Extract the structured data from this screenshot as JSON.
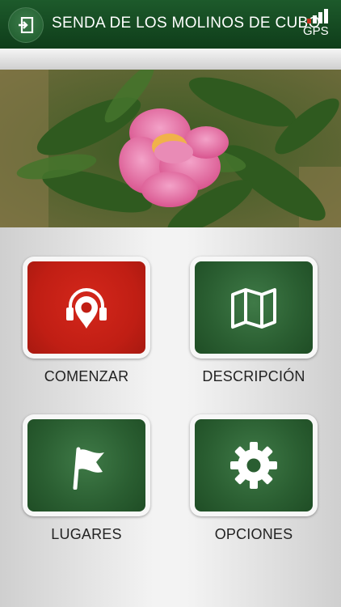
{
  "header": {
    "title": "SENDA DE LOS MOLINOS DE CUBO",
    "gps_label": "GPS"
  },
  "icons": {
    "back": "exit-icon",
    "gps": "gps-signal-icon",
    "start": "audio-guide-location-icon",
    "description": "map-icon",
    "places": "flag-icon",
    "options": "gear-icon"
  },
  "menu": {
    "start_label": "COMENZAR",
    "description_label": "DESCRIPCIÓN",
    "places_label": "LUGARES",
    "options_label": "OPCIONES"
  },
  "colors": {
    "header_green": "#1d5a2b",
    "tile_green": "#2a5e31",
    "tile_red": "#c01e14"
  }
}
